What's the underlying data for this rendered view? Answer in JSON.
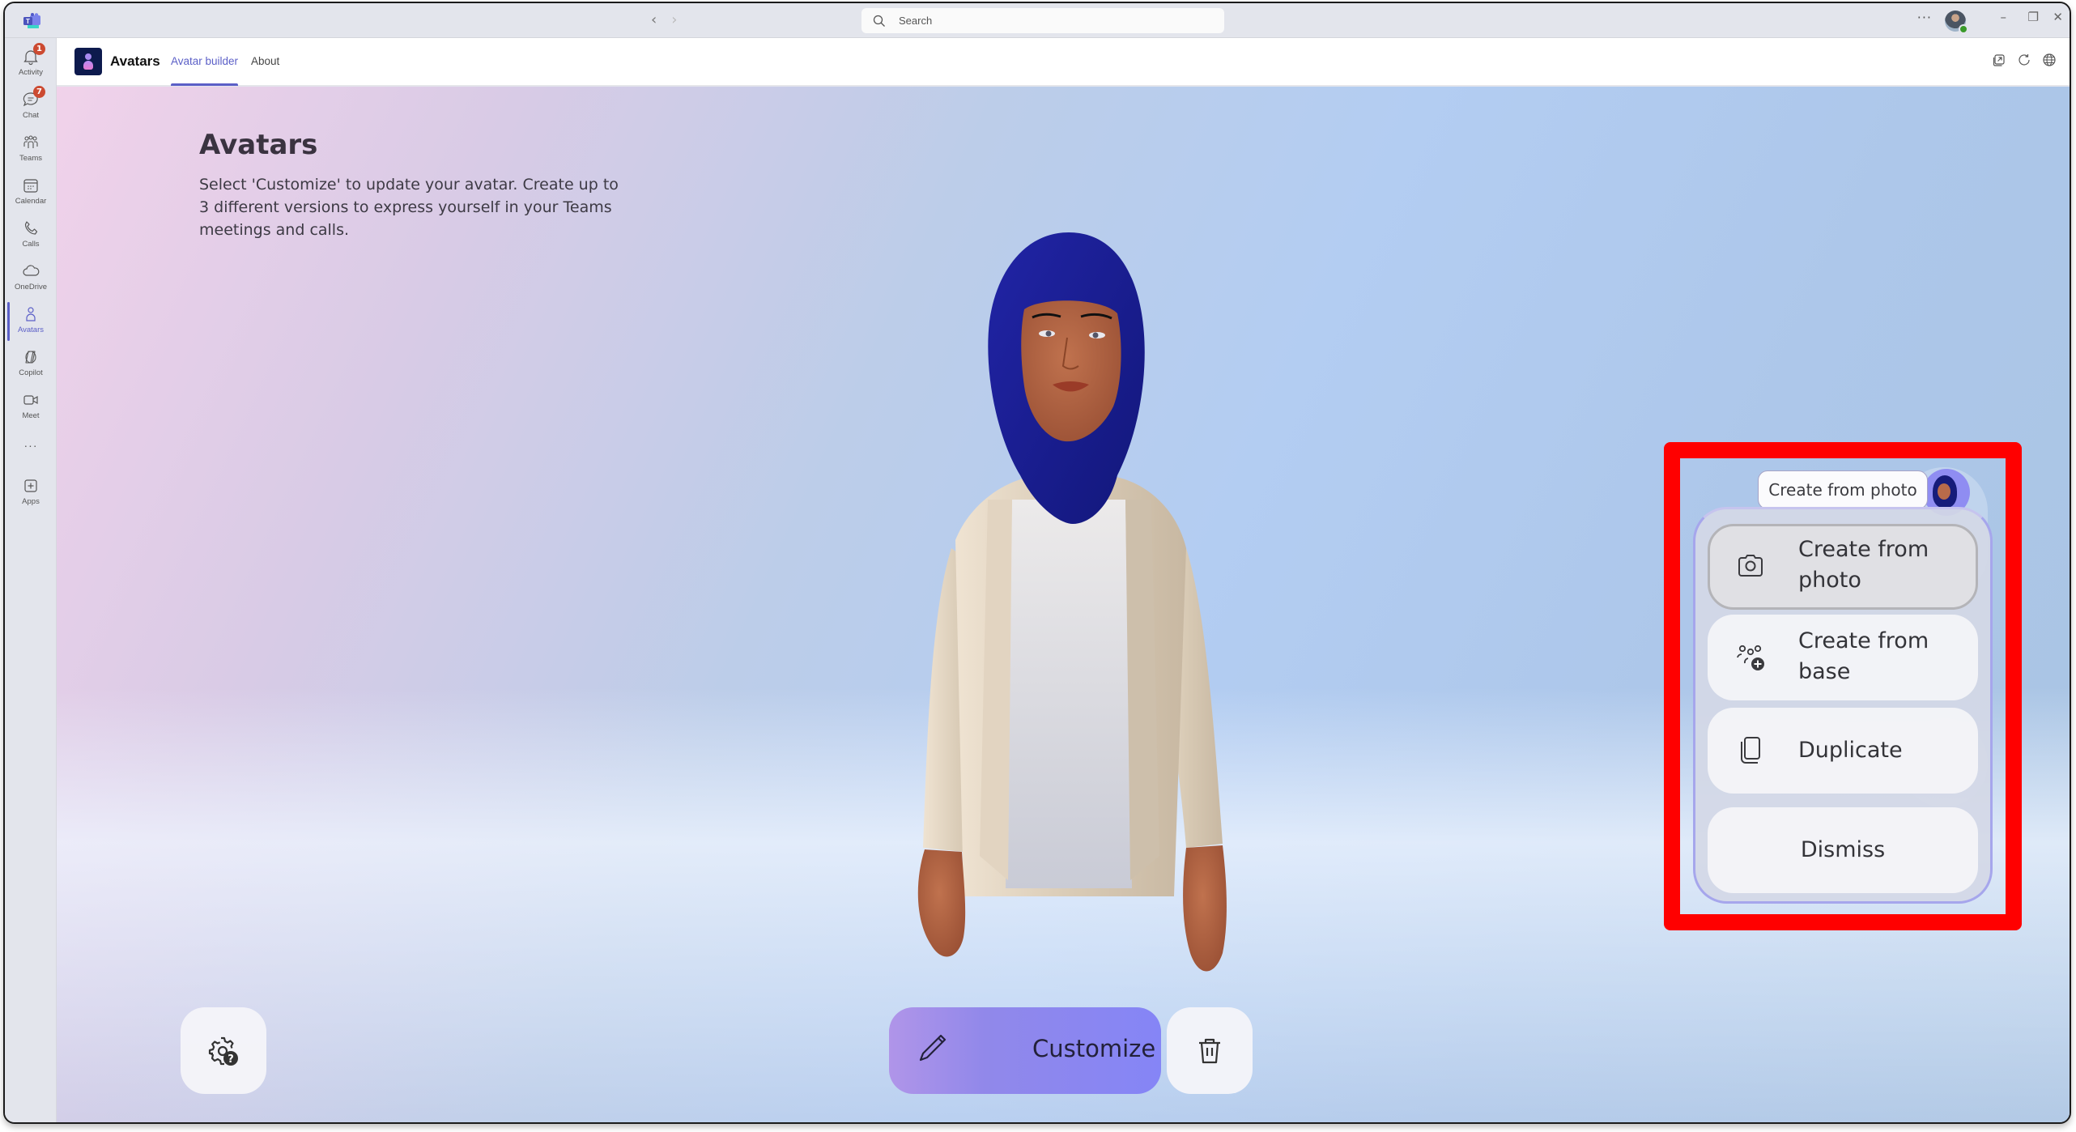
{
  "titlebar": {
    "search_placeholder": "Search",
    "more_label": "···",
    "minimize_label": "–",
    "restore_label": "❐",
    "close_label": "✕"
  },
  "sidebar": {
    "items": [
      {
        "label": "Activity",
        "icon": "bell-icon",
        "badge": "1"
      },
      {
        "label": "Chat",
        "icon": "chat-icon",
        "badge": "7"
      },
      {
        "label": "Teams",
        "icon": "teams-icon"
      },
      {
        "label": "Calendar",
        "icon": "calendar-icon"
      },
      {
        "label": "Calls",
        "icon": "phone-icon"
      },
      {
        "label": "OneDrive",
        "icon": "cloud-icon"
      },
      {
        "label": "Avatars",
        "icon": "person-icon",
        "active": true
      },
      {
        "label": "Copilot",
        "icon": "copilot-icon"
      },
      {
        "label": "Meet",
        "icon": "video-icon"
      },
      {
        "label": "···",
        "icon": "more-icon"
      },
      {
        "label": "Apps",
        "icon": "add-app-icon"
      }
    ]
  },
  "app": {
    "title": "Avatars",
    "tabs": [
      {
        "label": "Avatar builder",
        "active": true
      },
      {
        "label": "About",
        "active": false
      }
    ]
  },
  "main": {
    "title": "Avatars",
    "description": "Select 'Customize' to update your avatar. Create up to 3 different versions to express yourself in your Teams meetings and calls.",
    "customize_label": "Customize"
  },
  "menu": {
    "tooltip": "Create from photo",
    "items": [
      {
        "label": "Create from photo",
        "icon": "camera-icon",
        "focused": true
      },
      {
        "label": "Create from base",
        "icon": "people-add-icon"
      },
      {
        "label": "Duplicate",
        "icon": "copy-icon"
      },
      {
        "label": "Dismiss"
      }
    ]
  },
  "colors": {
    "accent": "#5b5fc7",
    "highlight": "#ff0000",
    "customize_gradient_start": "#b095e9",
    "customize_gradient_end": "#8585f6",
    "hijab": "#1a1f96"
  }
}
